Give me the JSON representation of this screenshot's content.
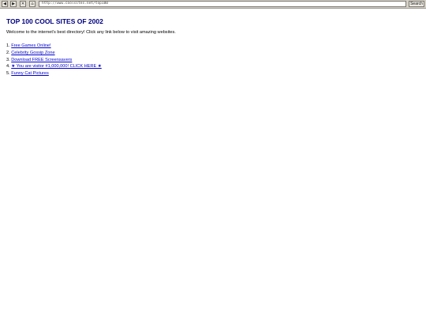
{
  "toolbar": {
    "back_label": "◀",
    "forward_label": "▶",
    "stop_label": "✕",
    "home_label": "⌂",
    "address_value": "http://www.coolsites.net/top100",
    "search_label": "Search"
  },
  "page": {
    "title": "TOP 100 COOL SITES OF 2002",
    "intro": "Welcome to the internet's best directory! Click any link below to visit amazing websites.",
    "links": [
      {
        "number": "1.",
        "label": "Free Games Online!"
      },
      {
        "number": "2.",
        "label": "Celebrity Gossip Zone"
      },
      {
        "number": "3.",
        "label": "Download FREE Screensavers"
      },
      {
        "number": "4.",
        "label": "★ You are visitor #1,000,000! CLICK HERE ★"
      },
      {
        "number": "5.",
        "label": "Funny Cat Pictures"
      }
    ]
  },
  "colors": {
    "title": "#000080",
    "link": "#0000cc",
    "toolbar": "#d4d0c8"
  },
  "icons": {
    "back": "back-arrow-icon",
    "forward": "forward-arrow-icon",
    "stop": "stop-icon",
    "home": "home-icon"
  }
}
